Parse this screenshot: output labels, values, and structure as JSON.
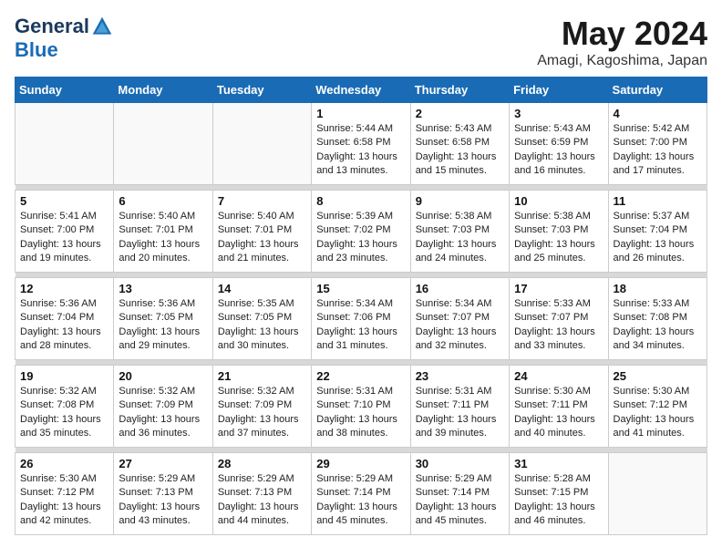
{
  "logo": {
    "general": "General",
    "blue": "Blue"
  },
  "title": "May 2024",
  "location": "Amagi, Kagoshima, Japan",
  "weekdays": [
    "Sunday",
    "Monday",
    "Tuesday",
    "Wednesday",
    "Thursday",
    "Friday",
    "Saturday"
  ],
  "weeks": [
    [
      {
        "day": "",
        "info": ""
      },
      {
        "day": "",
        "info": ""
      },
      {
        "day": "",
        "info": ""
      },
      {
        "day": "1",
        "info": "Sunrise: 5:44 AM\nSunset: 6:58 PM\nDaylight: 13 hours\nand 13 minutes."
      },
      {
        "day": "2",
        "info": "Sunrise: 5:43 AM\nSunset: 6:58 PM\nDaylight: 13 hours\nand 15 minutes."
      },
      {
        "day": "3",
        "info": "Sunrise: 5:43 AM\nSunset: 6:59 PM\nDaylight: 13 hours\nand 16 minutes."
      },
      {
        "day": "4",
        "info": "Sunrise: 5:42 AM\nSunset: 7:00 PM\nDaylight: 13 hours\nand 17 minutes."
      }
    ],
    [
      {
        "day": "5",
        "info": "Sunrise: 5:41 AM\nSunset: 7:00 PM\nDaylight: 13 hours\nand 19 minutes."
      },
      {
        "day": "6",
        "info": "Sunrise: 5:40 AM\nSunset: 7:01 PM\nDaylight: 13 hours\nand 20 minutes."
      },
      {
        "day": "7",
        "info": "Sunrise: 5:40 AM\nSunset: 7:01 PM\nDaylight: 13 hours\nand 21 minutes."
      },
      {
        "day": "8",
        "info": "Sunrise: 5:39 AM\nSunset: 7:02 PM\nDaylight: 13 hours\nand 23 minutes."
      },
      {
        "day": "9",
        "info": "Sunrise: 5:38 AM\nSunset: 7:03 PM\nDaylight: 13 hours\nand 24 minutes."
      },
      {
        "day": "10",
        "info": "Sunrise: 5:38 AM\nSunset: 7:03 PM\nDaylight: 13 hours\nand 25 minutes."
      },
      {
        "day": "11",
        "info": "Sunrise: 5:37 AM\nSunset: 7:04 PM\nDaylight: 13 hours\nand 26 minutes."
      }
    ],
    [
      {
        "day": "12",
        "info": "Sunrise: 5:36 AM\nSunset: 7:04 PM\nDaylight: 13 hours\nand 28 minutes."
      },
      {
        "day": "13",
        "info": "Sunrise: 5:36 AM\nSunset: 7:05 PM\nDaylight: 13 hours\nand 29 minutes."
      },
      {
        "day": "14",
        "info": "Sunrise: 5:35 AM\nSunset: 7:05 PM\nDaylight: 13 hours\nand 30 minutes."
      },
      {
        "day": "15",
        "info": "Sunrise: 5:34 AM\nSunset: 7:06 PM\nDaylight: 13 hours\nand 31 minutes."
      },
      {
        "day": "16",
        "info": "Sunrise: 5:34 AM\nSunset: 7:07 PM\nDaylight: 13 hours\nand 32 minutes."
      },
      {
        "day": "17",
        "info": "Sunrise: 5:33 AM\nSunset: 7:07 PM\nDaylight: 13 hours\nand 33 minutes."
      },
      {
        "day": "18",
        "info": "Sunrise: 5:33 AM\nSunset: 7:08 PM\nDaylight: 13 hours\nand 34 minutes."
      }
    ],
    [
      {
        "day": "19",
        "info": "Sunrise: 5:32 AM\nSunset: 7:08 PM\nDaylight: 13 hours\nand 35 minutes."
      },
      {
        "day": "20",
        "info": "Sunrise: 5:32 AM\nSunset: 7:09 PM\nDaylight: 13 hours\nand 36 minutes."
      },
      {
        "day": "21",
        "info": "Sunrise: 5:32 AM\nSunset: 7:09 PM\nDaylight: 13 hours\nand 37 minutes."
      },
      {
        "day": "22",
        "info": "Sunrise: 5:31 AM\nSunset: 7:10 PM\nDaylight: 13 hours\nand 38 minutes."
      },
      {
        "day": "23",
        "info": "Sunrise: 5:31 AM\nSunset: 7:11 PM\nDaylight: 13 hours\nand 39 minutes."
      },
      {
        "day": "24",
        "info": "Sunrise: 5:30 AM\nSunset: 7:11 PM\nDaylight: 13 hours\nand 40 minutes."
      },
      {
        "day": "25",
        "info": "Sunrise: 5:30 AM\nSunset: 7:12 PM\nDaylight: 13 hours\nand 41 minutes."
      }
    ],
    [
      {
        "day": "26",
        "info": "Sunrise: 5:30 AM\nSunset: 7:12 PM\nDaylight: 13 hours\nand 42 minutes."
      },
      {
        "day": "27",
        "info": "Sunrise: 5:29 AM\nSunset: 7:13 PM\nDaylight: 13 hours\nand 43 minutes."
      },
      {
        "day": "28",
        "info": "Sunrise: 5:29 AM\nSunset: 7:13 PM\nDaylight: 13 hours\nand 44 minutes."
      },
      {
        "day": "29",
        "info": "Sunrise: 5:29 AM\nSunset: 7:14 PM\nDaylight: 13 hours\nand 45 minutes."
      },
      {
        "day": "30",
        "info": "Sunrise: 5:29 AM\nSunset: 7:14 PM\nDaylight: 13 hours\nand 45 minutes."
      },
      {
        "day": "31",
        "info": "Sunrise: 5:28 AM\nSunset: 7:15 PM\nDaylight: 13 hours\nand 46 minutes."
      },
      {
        "day": "",
        "info": ""
      }
    ]
  ]
}
